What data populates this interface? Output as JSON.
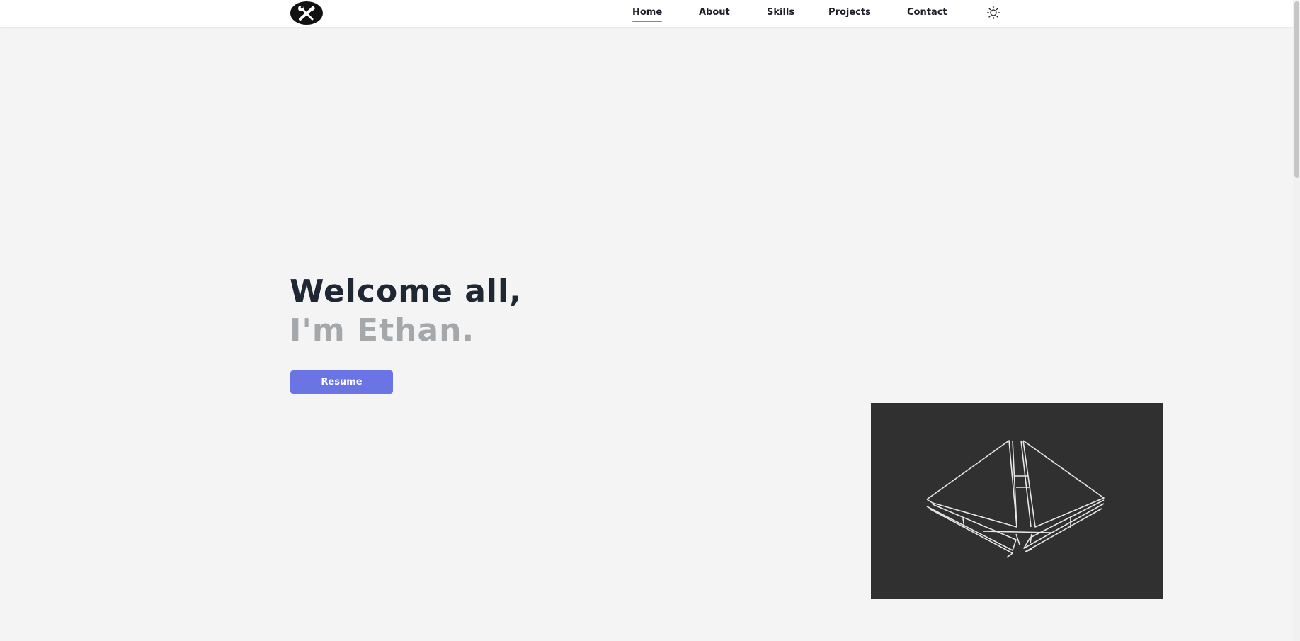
{
  "nav": {
    "logo_icon": "tools-icon",
    "links": [
      "Home",
      "About",
      "Skills",
      "Projects",
      "Contact"
    ],
    "active": "Home",
    "theme_icon": "sun-icon",
    "accent": "#7b7ed6"
  },
  "hero": {
    "line1": "Welcome all,",
    "line2": "I'm Ethan.",
    "resume_label": "Resume",
    "title_color": "#1f2733",
    "subtitle_color": "#a5a8ab",
    "button_color": "#6b74e4"
  },
  "render": {
    "icon": "ethereum-wireframe-icon",
    "background": "#303030"
  }
}
